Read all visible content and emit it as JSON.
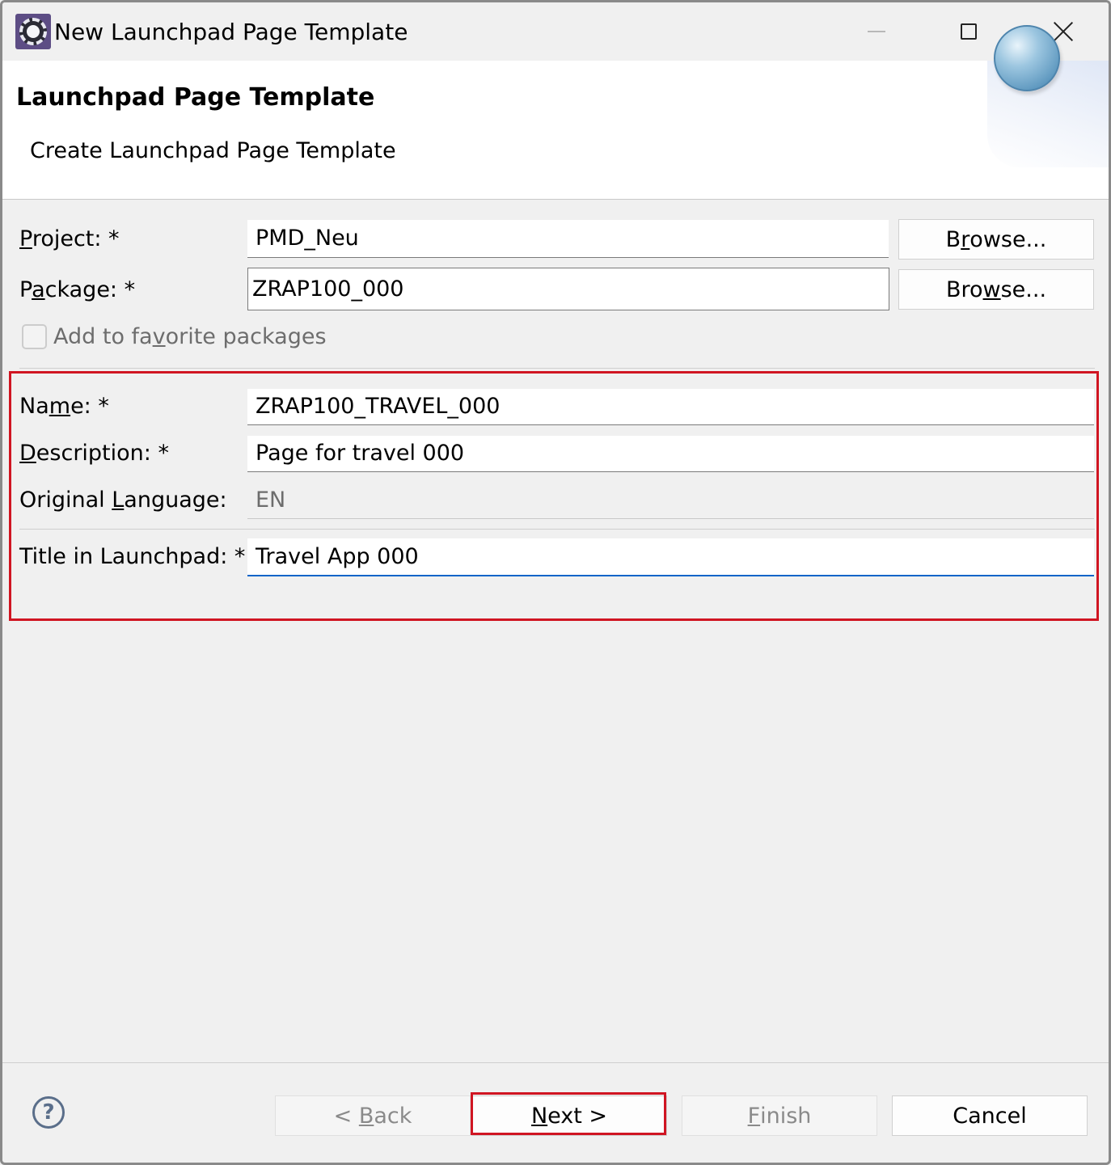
{
  "window": {
    "title": "New Launchpad Page Template"
  },
  "banner": {
    "title": "Launchpad Page Template",
    "subtitle": "Create Launchpad Page Template"
  },
  "form": {
    "project": {
      "label_pre": "",
      "label_mnemonic": "P",
      "label_post": "roject: *",
      "value": "PMD_Neu",
      "browse_pre": "B",
      "browse_mnemonic": "r",
      "browse_post": "owse..."
    },
    "package": {
      "label_pre": "P",
      "label_mnemonic": "a",
      "label_post": "ckage: *",
      "value": "ZRAP100_000",
      "browse_pre": "Bro",
      "browse_mnemonic": "w",
      "browse_post": "se..."
    },
    "favorite": {
      "label_pre": "Add to fa",
      "label_mnemonic": "v",
      "label_post": "orite packages",
      "checked": false
    },
    "name": {
      "label_pre": "Na",
      "label_mnemonic": "m",
      "label_post": "e: *",
      "value": "ZRAP100_TRAVEL_000"
    },
    "description": {
      "label_pre": "",
      "label_mnemonic": "D",
      "label_post": "escription: *",
      "value": "Page for travel 000"
    },
    "original_language": {
      "label_pre": "Original ",
      "label_mnemonic": "L",
      "label_post": "anguage:",
      "value": "EN"
    },
    "title_in_launchpad": {
      "label": "Title in Launchpad: *",
      "value": "Travel App 000"
    }
  },
  "footer": {
    "help_glyph": "?",
    "back": {
      "pre": "< ",
      "mnemonic": "B",
      "post": "ack"
    },
    "next": {
      "pre": "",
      "mnemonic": "N",
      "post": "ext >"
    },
    "finish": {
      "pre": "",
      "mnemonic": "F",
      "post": "inish"
    },
    "cancel": "Cancel"
  },
  "colors": {
    "highlight": "#d01522",
    "focus": "#0a64c8"
  },
  "icons": {
    "app": "eclipse-gear-icon",
    "help": "help-icon",
    "banner": "wizard-sphere-icon"
  }
}
